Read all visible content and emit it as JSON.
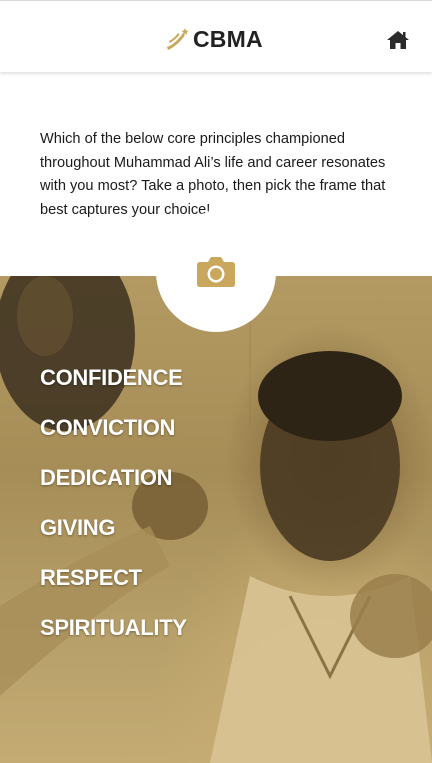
{
  "header": {
    "brand": "CBMA",
    "home_icon": "home-icon",
    "logo_icon": "cbma-logo-mark"
  },
  "intro": {
    "text": "Which of the below core principles championed throughout Muhammad Ali’s life and career resonates with you most? Take a photo, then pick the frame that best captures your choice!"
  },
  "camera": {
    "icon": "camera-icon"
  },
  "principles": [
    "CONFIDENCE",
    "CONVICTION",
    "DEDICATION",
    "GIVING",
    "RESPECT",
    "SPIRITUALITY"
  ],
  "colors": {
    "accent_gold": "#c9a75c",
    "text_dark": "#1a1a1a",
    "principle_text": "#ffffff"
  }
}
